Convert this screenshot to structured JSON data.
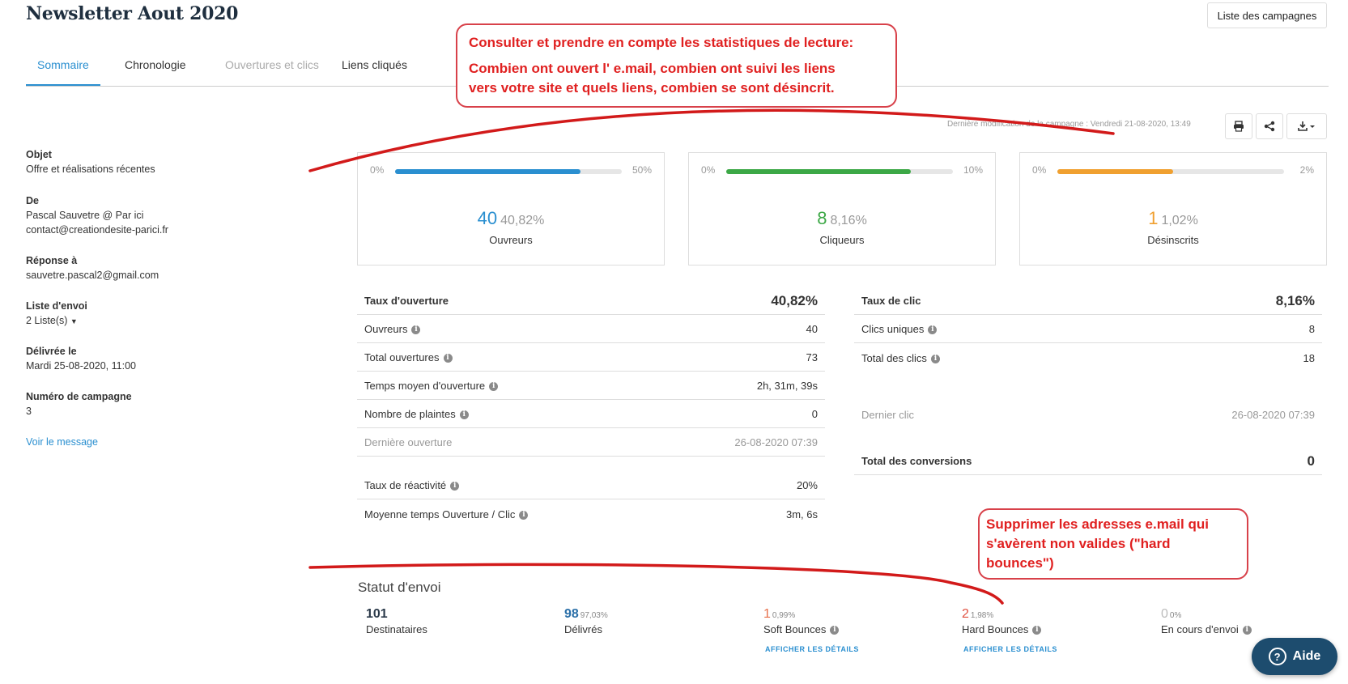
{
  "header": {
    "title": "Newsletter Aout 2020",
    "campaigns_button": "Liste des campagnes"
  },
  "tabs": [
    {
      "label": "Sommaire",
      "state": "active"
    },
    {
      "label": "Chronologie",
      "state": "normal"
    },
    {
      "label": "Ouvertures et clics",
      "state": "disabled"
    },
    {
      "label": "Liens cliqués",
      "state": "normal"
    }
  ],
  "annotations": {
    "top": {
      "line1": "Consulter et prendre en compte les statistiques de lecture:",
      "line2": "Combien ont ouvert l' e.mail, combien ont suivi les liens",
      "line3": "vers votre site et quels liens, combien se sont désincrit."
    },
    "bottom": {
      "line1": "Supprimer les adresses e.mail qui",
      "line2": "s'avèrent non valides (\"hard",
      "line3": "bounces\")"
    },
    "color": "#e02020"
  },
  "sidebar": {
    "subject_label": "Objet",
    "subject_value": "Offre et réalisations récentes",
    "from_label": "De",
    "from_name": "Pascal Sauvetre @ Par ici",
    "from_email": "contact@creationdesite-parici.fr",
    "reply_label": "Réponse à",
    "reply_value": "sauvetre.pascal2@gmail.com",
    "list_label": "Liste d'envoi",
    "list_value": "2 Liste(s)",
    "delivered_label": "Délivrée le",
    "delivered_value": "Mardi 25-08-2020, 11:00",
    "campaign_no_label": "Numéro de campagne",
    "campaign_no_value": "3",
    "view_message_link": "Voir le message"
  },
  "last_modified": {
    "label": "Dernière modification de la campagne :",
    "value": "Vendredi 21-08-2020, 13:49"
  },
  "toolbar_icons": [
    "print-icon",
    "share-icon",
    "download-icon"
  ],
  "cards": [
    {
      "min": "0%",
      "max": "50%",
      "fill_fraction": 0.8164,
      "color": "#2a8fd0",
      "count": "40",
      "percent": "40,82%",
      "label": "Ouvreurs"
    },
    {
      "min": "0%",
      "max": "10%",
      "fill_fraction": 0.816,
      "color": "#3ca846",
      "count": "8",
      "percent": "8,16%",
      "label": "Cliqueurs"
    },
    {
      "min": "0%",
      "max": "2%",
      "fill_fraction": 0.51,
      "color": "#f0a030",
      "count": "1",
      "percent": "1,02%",
      "label": "Désinscrits"
    }
  ],
  "open_stats": {
    "header_label": "Taux d'ouverture",
    "header_value": "40,82%",
    "rows": [
      {
        "label": "Ouvreurs",
        "value": "40"
      },
      {
        "label": "Total ouvertures",
        "value": "73"
      },
      {
        "label": "Temps moyen d'ouverture",
        "value": "2h, 31m, 39s"
      },
      {
        "label": "Nombre de plaintes",
        "value": "0"
      }
    ],
    "last_open_label": "Dernière ouverture",
    "last_open_value": "26-08-2020 07:39",
    "reactivity_label": "Taux de réactivité",
    "reactivity_value": "20%",
    "avg_open_click_label": "Moyenne temps Ouverture / Clic",
    "avg_open_click_value": "3m, 6s"
  },
  "click_stats": {
    "header_label": "Taux de clic",
    "header_value": "8,16%",
    "rows": [
      {
        "label": "Clics uniques",
        "value": "8"
      },
      {
        "label": "Total des clics",
        "value": "18"
      }
    ],
    "last_click_label": "Dernier clic",
    "last_click_value": "26-08-2020 07:39",
    "conversions_label": "Total des conversions",
    "conversions_value": "0"
  },
  "send_status": {
    "title": "Statut d'envoi",
    "items": [
      {
        "count": "101",
        "percent": "",
        "label": "Destinataires",
        "color": "#2b3a4a",
        "details": ""
      },
      {
        "count": "98",
        "percent": "97,03%",
        "label": "Délivrés",
        "color": "#2a6fa8",
        "details": ""
      },
      {
        "count": "1",
        "percent": "0,99%",
        "label": "Soft Bounces",
        "color": "#e8704a",
        "details": "AFFICHER LES DÉTAILS"
      },
      {
        "count": "2",
        "percent": "1,98%",
        "label": "Hard Bounces",
        "color": "#e05040",
        "details": "AFFICHER LES DÉTAILS"
      },
      {
        "count": "0",
        "percent": "0%",
        "label": "En cours d'envoi",
        "color": "#bbbbbb",
        "details": ""
      }
    ]
  },
  "help_button": "Aide"
}
